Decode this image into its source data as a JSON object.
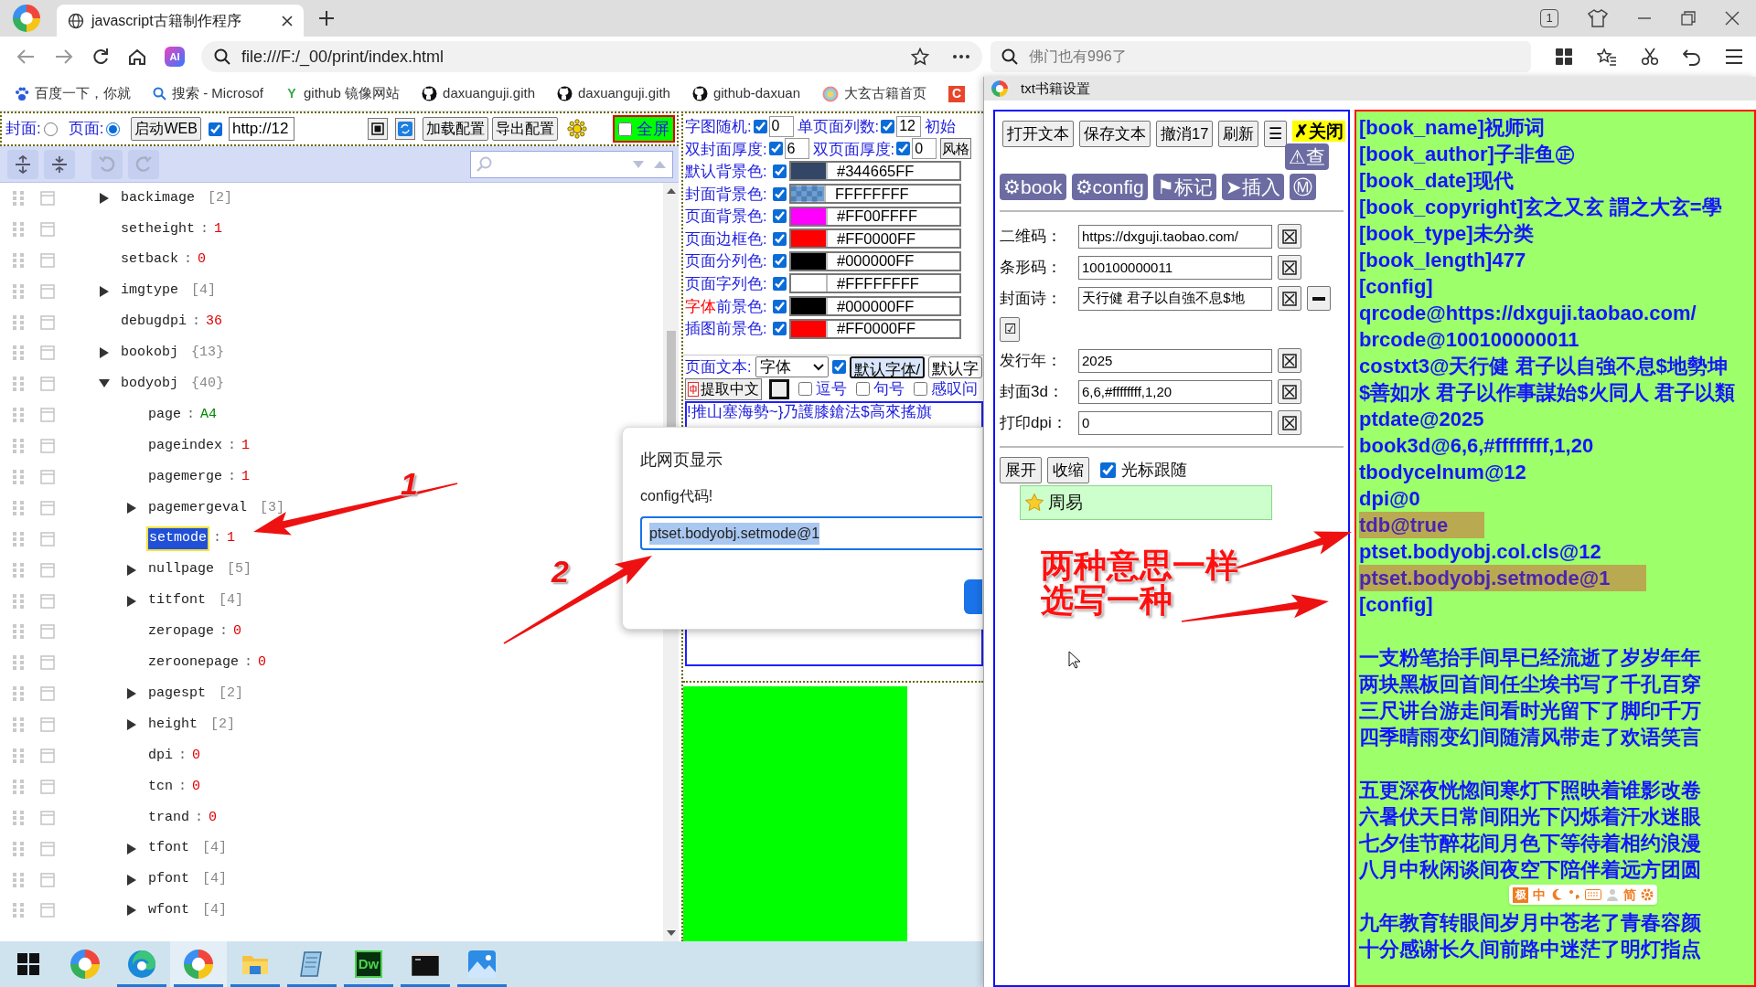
{
  "browser": {
    "tab_title": "javascript古籍制作程序",
    "tab_count": "1",
    "ai_label": "AI",
    "url": "file:///F:/_00/print/index.html",
    "search_placeholder": "佛门也有996了",
    "bookmarks": [
      {
        "kind": "paw",
        "label": "百度一下，你就"
      },
      {
        "kind": "search",
        "label": "搜索 - Microsof"
      },
      {
        "kind": "letter",
        "glyph": "Y",
        "label": "github 镜像网站"
      },
      {
        "kind": "github",
        "label": "daxuanguji.gith"
      },
      {
        "kind": "github",
        "label": "daxuanguji.gith"
      },
      {
        "kind": "github",
        "label": "github-daxuan"
      },
      {
        "kind": "ring",
        "label": "大玄古籍首页"
      },
      {
        "kind": "tile",
        "glyph": "C"
      }
    ]
  },
  "page_toolbar": {
    "radios": [
      {
        "label": "封面:",
        "selected": false
      },
      {
        "label": "页面:",
        "selected": true
      }
    ],
    "web_button": "启动WEB",
    "web_checked": true,
    "url": "http://12",
    "load_button": "加载配置",
    "export_button": "导出配置",
    "fullscreen": {
      "label": "全屏",
      "checked": false
    }
  },
  "tree": {
    "separator": ":",
    "rows": [
      {
        "key": "backimage",
        "kind": "array",
        "count": "[2]",
        "expanded": false,
        "selected": false
      },
      {
        "key": "setheight",
        "kind": "number",
        "value": "1",
        "selected": false
      },
      {
        "key": "setback",
        "kind": "number",
        "value": "0",
        "selected": false
      },
      {
        "key": "imgtype",
        "kind": "array",
        "count": "[4]",
        "expanded": false,
        "selected": false
      },
      {
        "key": "debugdpi",
        "kind": "number",
        "value": "36",
        "selected": false
      },
      {
        "key": "bookobj",
        "kind": "object",
        "count": "{13}",
        "expanded": false,
        "selected": false
      },
      {
        "key": "bodyobj",
        "kind": "object",
        "count": "{40}",
        "expanded": true,
        "selected": false,
        "children": [
          {
            "key": "page",
            "kind": "string",
            "value": "A4",
            "selected": false
          },
          {
            "key": "pageindex",
            "kind": "number",
            "value": "1",
            "selected": false
          },
          {
            "key": "pagemerge",
            "kind": "number",
            "value": "1",
            "selected": false
          },
          {
            "key": "pagemergeval",
            "kind": "array",
            "count": "[3]",
            "expanded": false,
            "selected": false
          },
          {
            "key": "setmode",
            "kind": "number",
            "value": "1",
            "selected": true
          },
          {
            "key": "nullpage",
            "kind": "array",
            "count": "[5]",
            "expanded": false,
            "selected": false
          },
          {
            "key": "titfont",
            "kind": "array",
            "count": "[4]",
            "expanded": false,
            "selected": false
          },
          {
            "key": "zeropage",
            "kind": "number",
            "value": "0",
            "selected": false
          },
          {
            "key": "zeroonepage",
            "kind": "number",
            "value": "0",
            "selected": false
          },
          {
            "key": "pagespt",
            "kind": "array",
            "count": "[2]",
            "expanded": false,
            "selected": false
          },
          {
            "key": "height",
            "kind": "array",
            "count": "[2]",
            "expanded": false,
            "selected": false
          },
          {
            "key": "dpi",
            "kind": "number",
            "value": "0",
            "selected": false
          },
          {
            "key": "tcn",
            "kind": "number",
            "value": "0",
            "selected": false
          },
          {
            "key": "trand",
            "kind": "number",
            "value": "0",
            "selected": false
          },
          {
            "key": "tfont",
            "kind": "array",
            "count": "[4]",
            "expanded": false,
            "selected": false
          },
          {
            "key": "pfont",
            "kind": "array",
            "count": "[4]",
            "expanded": false,
            "selected": false
          },
          {
            "key": "wfont",
            "kind": "array",
            "count": "[4]",
            "expanded": false,
            "selected": false
          }
        ]
      }
    ]
  },
  "settings": {
    "number_rows": [
      [
        {
          "kind": "number",
          "label": "字图随机:",
          "checked": true,
          "value": "0"
        },
        {
          "kind": "number",
          "label": "单页面列数:",
          "checked": true,
          "value": "12"
        },
        {
          "kind": "label",
          "label": "初始"
        }
      ],
      [
        {
          "kind": "number",
          "label": "双封面厚度:",
          "checked": true,
          "value": "6"
        },
        {
          "kind": "number",
          "label": "双页面厚度:",
          "checked": true,
          "value": "0"
        },
        {
          "kind": "button",
          "label": "风格"
        }
      ]
    ],
    "color_rows": [
      {
        "kind": "solid",
        "label": "默认背景色:",
        "checked": true,
        "color": "#344665",
        "value": "#344665FF"
      },
      {
        "kind": "pattern",
        "label": "封面背景色:",
        "checked": true,
        "value": "FFFFFFFF"
      },
      {
        "kind": "solid",
        "label": "页面背景色:",
        "checked": true,
        "color": "#ff00ff",
        "value": "#FF00FFFF"
      },
      {
        "kind": "solid",
        "label": "页面边框色:",
        "checked": true,
        "color": "#ff0000",
        "value": "#FF0000FF"
      },
      {
        "kind": "solid",
        "label": "页面分列色:",
        "checked": true,
        "color": "#000000",
        "value": "#000000FF"
      },
      {
        "kind": "solid",
        "label": "页面字列色:",
        "checked": true,
        "color": "#ffffff",
        "value": "#FFFFFFFF"
      },
      {
        "kind": "solid",
        "accent": "字体",
        "label": "前景色:",
        "checked": true,
        "color": "#000000",
        "value": "#000000FF"
      },
      {
        "kind": "solid",
        "label": "插图前景色:",
        "checked": true,
        "color": "#ff0000",
        "value": "#FF0000FF"
      }
    ],
    "text_row": {
      "label": "页面文本:",
      "select": "字体",
      "checked": true,
      "button": "默认字体/",
      "button2": "默认字"
    },
    "extract_row": {
      "button": "提取中文",
      "marks": [
        {
          "label": "逗号",
          "checked": false
        },
        {
          "label": "句号",
          "checked": false
        },
        {
          "label": "感叹问",
          "checked": false
        }
      ]
    },
    "preview": "!推山塞海勢~}乃護膝鎗法$高來搖旗"
  },
  "dialog": {
    "title": "此网页显示",
    "message": "config代码!",
    "value": "ptset.bodyobj.setmode@1"
  },
  "panel_window": {
    "title": "txt书籍设置",
    "toolbar": [
      "打开文本",
      "保存文本",
      "撤消17",
      "刷新",
      "☰"
    ],
    "close": "✗关闭",
    "check": "⚠查",
    "actions": [
      "⚙book",
      "⚙config",
      "⚑标记",
      "➤插入",
      "Ⓜ"
    ],
    "fields": [
      {
        "kind": "plain",
        "label": "二维码：",
        "value": "https://dxguji.taobao.com/"
      },
      {
        "kind": "plain",
        "label": "条形码：",
        "value": "100100000011"
      },
      {
        "kind": "extra",
        "label": "封面诗：",
        "value": "天行健 君子以自強不息$地"
      },
      {
        "kind": "toggle",
        "glyph": "☑"
      },
      {
        "kind": "plain",
        "label": "发行年：",
        "value": "2025"
      },
      {
        "kind": "plain",
        "label": "封面3d：",
        "value": "6,6,#ffffffff,1,20"
      },
      {
        "kind": "plain",
        "label": "打印dpi：",
        "value": "0"
      }
    ],
    "expand": "展开",
    "collapse": "收缩",
    "follow": {
      "label": "光标跟随",
      "checked": true
    },
    "tree": [
      {
        "label": "周易",
        "selected": true
      }
    ]
  },
  "book_text": {
    "lines": [
      {
        "kind": "text",
        "text": "[book_name]祝师词",
        "highlight": false
      },
      {
        "kind": "text",
        "text": "[book_author]子非鱼㊣",
        "highlight": false
      },
      {
        "kind": "text",
        "text": "[book_date]现代",
        "highlight": false
      },
      {
        "kind": "text",
        "text": "[book_copyright]玄之又玄 謂之大玄=學",
        "highlight": false
      },
      {
        "kind": "text",
        "text": "[book_type]未分类",
        "highlight": false
      },
      {
        "kind": "text",
        "text": "[book_length]477",
        "highlight": false
      },
      {
        "kind": "text",
        "text": "[config]",
        "highlight": false
      },
      {
        "kind": "text",
        "text": "qrcode@https://dxguji.taobao.com/",
        "highlight": false
      },
      {
        "kind": "text",
        "text": "brcode@100100000011",
        "highlight": false
      },
      {
        "kind": "text",
        "text": "costxt3@天行健 君子以自強不息$地勢坤",
        "highlight": false
      },
      {
        "kind": "text",
        "text": "$善如水 君子以作事謀始$火同人 君子以類",
        "highlight": false
      },
      {
        "kind": "text",
        "text": "ptdate@2025",
        "highlight": false
      },
      {
        "kind": "text",
        "text": "book3d@6,6,#ffffffff,1,20",
        "highlight": false
      },
      {
        "kind": "text",
        "text": "tbodycelnum@12",
        "highlight": false
      },
      {
        "kind": "text",
        "text": "dpi@0",
        "highlight": false
      },
      {
        "kind": "text",
        "text": "tdb@true",
        "highlight": true
      },
      {
        "kind": "text",
        "text": "ptset.bodyobj.col.cls@12",
        "highlight": false
      },
      {
        "kind": "text",
        "text": "ptset.bodyobj.setmode@1",
        "highlight": true
      },
      {
        "kind": "text",
        "text": "[config]",
        "highlight": false
      },
      {
        "kind": "gap"
      },
      {
        "kind": "text",
        "text": "一支粉笔抬手间早已经流逝了岁岁年年",
        "highlight": false
      },
      {
        "kind": "text",
        "text": "两块黑板回首间任尘埃书写了千孔百穿",
        "highlight": false
      },
      {
        "kind": "text",
        "text": "三尺讲台游走间看时光留下了脚印千万",
        "highlight": false
      },
      {
        "kind": "text",
        "text": "四季晴雨变幻间随清风带走了欢语笑言",
        "highlight": false
      },
      {
        "kind": "gap"
      },
      {
        "kind": "text",
        "text": "五更深夜恍惚间寒灯下照映着谁影改卷",
        "highlight": false
      },
      {
        "kind": "text",
        "text": "六暑伏天日常间阳光下闪烁着汗水迷眼",
        "highlight": false
      },
      {
        "kind": "text",
        "text": "七夕佳节醉花间月色下等待着相约浪漫",
        "highlight": false
      },
      {
        "kind": "text",
        "text": "八月中秋闲谈间夜空下陪伴着远方团圆",
        "highlight": false
      },
      {
        "kind": "gap"
      },
      {
        "kind": "text",
        "text": "九年教育转眼间岁月中苍老了青春容颜",
        "highlight": false
      },
      {
        "kind": "text",
        "text": "十分感谢长久间前路中迷茫了明灯指点",
        "highlight": false
      }
    ]
  },
  "ime_bar": {
    "logo": "极",
    "mode": "中",
    "script": "简"
  },
  "annotations": {
    "numbers": [
      "1",
      "2"
    ],
    "note": [
      "两种意思一样",
      "选写一种"
    ]
  },
  "taskbar": {
    "apps": [
      {
        "kind": "start",
        "running": false,
        "selected": false
      },
      {
        "kind": "browser",
        "running": false,
        "selected": false
      },
      {
        "kind": "edge",
        "running": true,
        "selected": false
      },
      {
        "kind": "browser",
        "running": true,
        "selected": true
      },
      {
        "kind": "folder",
        "running": true,
        "selected": false
      },
      {
        "kind": "notepad",
        "running": true,
        "selected": false
      },
      {
        "kind": "dw",
        "label": "Dw",
        "running": true,
        "selected": false
      },
      {
        "kind": "terminal",
        "running": true,
        "selected": false
      },
      {
        "kind": "photos",
        "running": true,
        "selected": false
      }
    ]
  }
}
